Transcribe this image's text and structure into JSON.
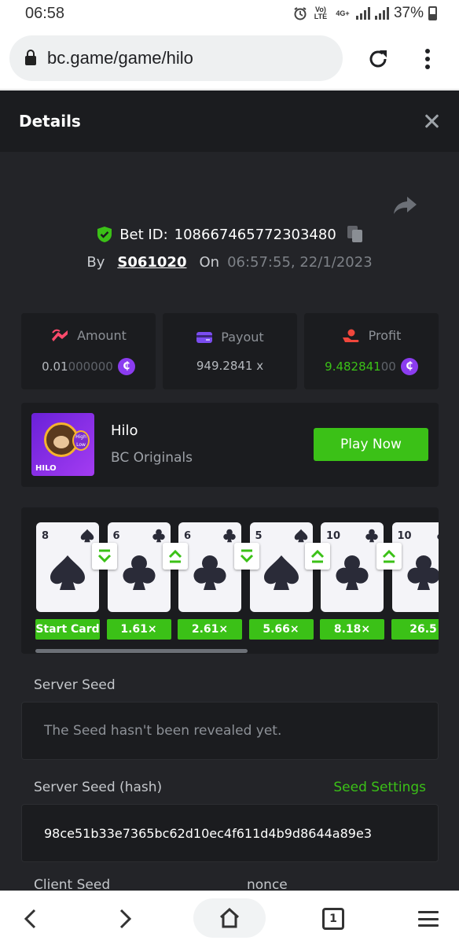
{
  "status_bar": {
    "time": "06:58",
    "network": "Vo) LTE",
    "net_type": "4G+",
    "battery": "37%"
  },
  "browser": {
    "url": "bc.game/game/hilo"
  },
  "modal": {
    "title": "Details"
  },
  "bet": {
    "id_label": "Bet ID:",
    "id": "108667465772303480",
    "by_label": "By",
    "user": "S061020",
    "on_label": "On",
    "datetime": "06:57:55, 22/1/2023"
  },
  "stats": {
    "amount": {
      "label": "Amount",
      "value_main": "0.01",
      "value_dim": "000000"
    },
    "payout": {
      "label": "Payout",
      "value": "949.2841 x"
    },
    "profit": {
      "label": "Profit",
      "value_main": "9.482841",
      "value_dim": "00"
    },
    "coin_symbol": "₵"
  },
  "game": {
    "name": "Hilo",
    "provider": "BC Originals",
    "play_label": "Play Now",
    "thumb_label": "HILO",
    "thumb_badge_1": "High",
    "thumb_badge_2": "Low"
  },
  "cards": [
    {
      "rank": "8",
      "suit": "spade",
      "mult": "Start Card"
    },
    {
      "rank": "6",
      "suit": "club",
      "mult": "1.61×",
      "arrow": "down"
    },
    {
      "rank": "6",
      "suit": "club",
      "mult": "2.61×",
      "arrow": "up"
    },
    {
      "rank": "5",
      "suit": "spade",
      "mult": "5.66×",
      "arrow": "down"
    },
    {
      "rank": "10",
      "suit": "club",
      "mult": "8.18×",
      "arrow": "up"
    },
    {
      "rank": "10",
      "suit": "club",
      "mult": "26.5",
      "arrow": "up"
    }
  ],
  "server_seed": {
    "label": "Server Seed",
    "value": "The Seed hasn't been revealed yet."
  },
  "server_seed_hash": {
    "label": "Server Seed (hash)",
    "settings_label": "Seed Settings",
    "value": "98ce51b33e7365bc62d10ec4f611d4b9d8644a89e3"
  },
  "client_seed": {
    "label": "Client Seed"
  },
  "nonce": {
    "label": "nonce"
  },
  "bottom_nav": {
    "tab_count": "1"
  },
  "colors": {
    "accent": "#3bc117",
    "background": "#232428",
    "panel": "#1b1c1f",
    "coin": "#8b3cf0"
  }
}
